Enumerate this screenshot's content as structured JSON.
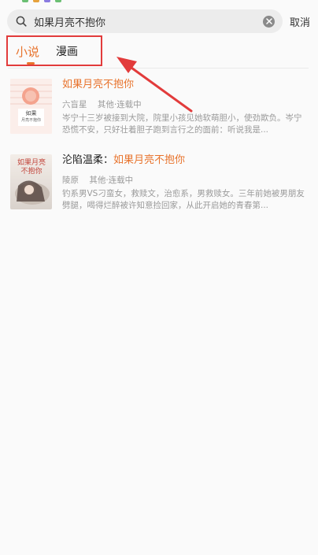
{
  "search": {
    "value": "如果月亮不抱你",
    "cancel_label": "取消"
  },
  "tabs": [
    {
      "label": "小说",
      "active": true
    },
    {
      "label": "漫画",
      "active": false
    }
  ],
  "results": [
    {
      "title_prefix": "",
      "title_highlight": "如果月亮不抱你",
      "author": "六盲星",
      "category": "其他",
      "status": "连载中",
      "description": "岑宁十三岁被接到大院，院里小孩见她软萌胆小，使劲欺负。岑宁恐慌不安，只好壮着胆子跑到言行之的面前：听说我是...",
      "cover_text_top": "如果",
      "cover_text_bottom": "月亮不抱你"
    },
    {
      "title_prefix": "沦陷温柔：",
      "title_highlight": "如果月亮不抱你",
      "author": "陵原",
      "category": "其他",
      "status": "连载中",
      "description": "钓系男VS刁蛮女，救赎文，治愈系，男救赎女。三年前她被男朋友劈腿，喝得烂醉被许知意捡回家，从此开启她的青春第...",
      "cover_text_top": "如果月亮",
      "cover_text_bottom": "不抱你"
    }
  ],
  "colors": {
    "accent": "#e8732c",
    "annotation": "#e23b3b"
  }
}
